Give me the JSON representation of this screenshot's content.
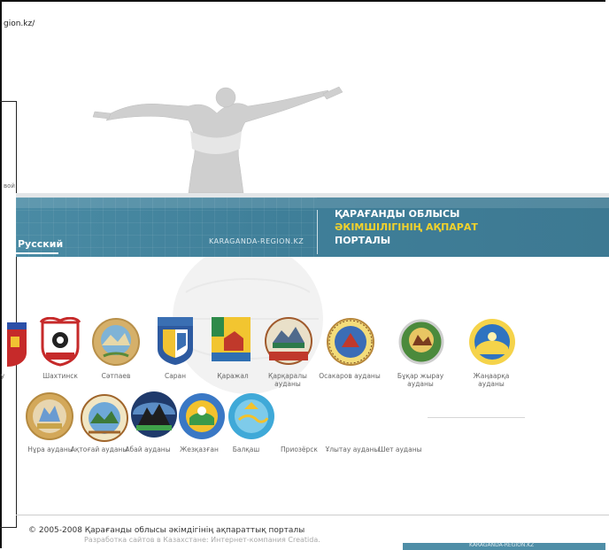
{
  "browser": {
    "address_fragment": "gion.kz/"
  },
  "header": {
    "nav_fragment": "вой",
    "language_label": "Русский",
    "site_url": "KARAGANDA-REGION.KZ",
    "title_line1": "ҚАРАҒАНДЫ ОБЛЫСЫ",
    "title_line2": "ӘКІМШІЛІГІНІҢ АҚПАРАТ",
    "title_line3": "ПОРТАЛЫ"
  },
  "regions": {
    "row1": [
      {
        "name": "у",
        "icon": "red-city-emblem-icon"
      },
      {
        "name": "Шахтинск",
        "icon": "shakhtinsk-emblem-icon"
      },
      {
        "name": "Сәтпаев",
        "icon": "satpaev-emblem-icon"
      },
      {
        "name": "Саран",
        "icon": "saran-emblem-icon"
      },
      {
        "name": "Қаражал",
        "icon": "karazhal-emblem-icon"
      },
      {
        "name": "Қарқаралы ауданы",
        "icon": "karkaraly-emblem-icon"
      },
      {
        "name": "Осакаров ауданы",
        "icon": "osakarov-emblem-icon"
      },
      {
        "name": "Бұқар жырау ауданы",
        "icon": "bukhar-zhyrau-emblem-icon"
      },
      {
        "name": "Жаңаарқа ауданы",
        "icon": "zhanaarka-emblem-icon"
      }
    ],
    "row2": [
      {
        "name": "Нұра ауданы",
        "icon": "nura-emblem-icon"
      },
      {
        "name": "Ақтоғай ауданы",
        "icon": "aktogay-emblem-icon"
      },
      {
        "name": "Абай ауданы",
        "icon": "abay-emblem-icon"
      },
      {
        "name": "Жезқазған",
        "icon": "zhezkazgan-emblem-icon"
      },
      {
        "name": "Балқаш",
        "icon": "balkhash-emblem-icon"
      },
      {
        "name": "Приозёрск",
        "icon": ""
      },
      {
        "name": "Ұлытау ауданы",
        "icon": ""
      },
      {
        "name": "Шет ауданы",
        "icon": ""
      }
    ]
  },
  "footer": {
    "copyright": "© 2005-2008 Қарағанды облысы әкімдігінің ақпараттық порталы",
    "developer": "Разработка сайтов в Казахстане: Интернет-компания Creatida.",
    "badge": "KARAGANDA-REGION.KZ"
  },
  "colors": {
    "banner": "#3f7f99",
    "title_accent": "#f2d22c",
    "label_gray": "#666666"
  }
}
